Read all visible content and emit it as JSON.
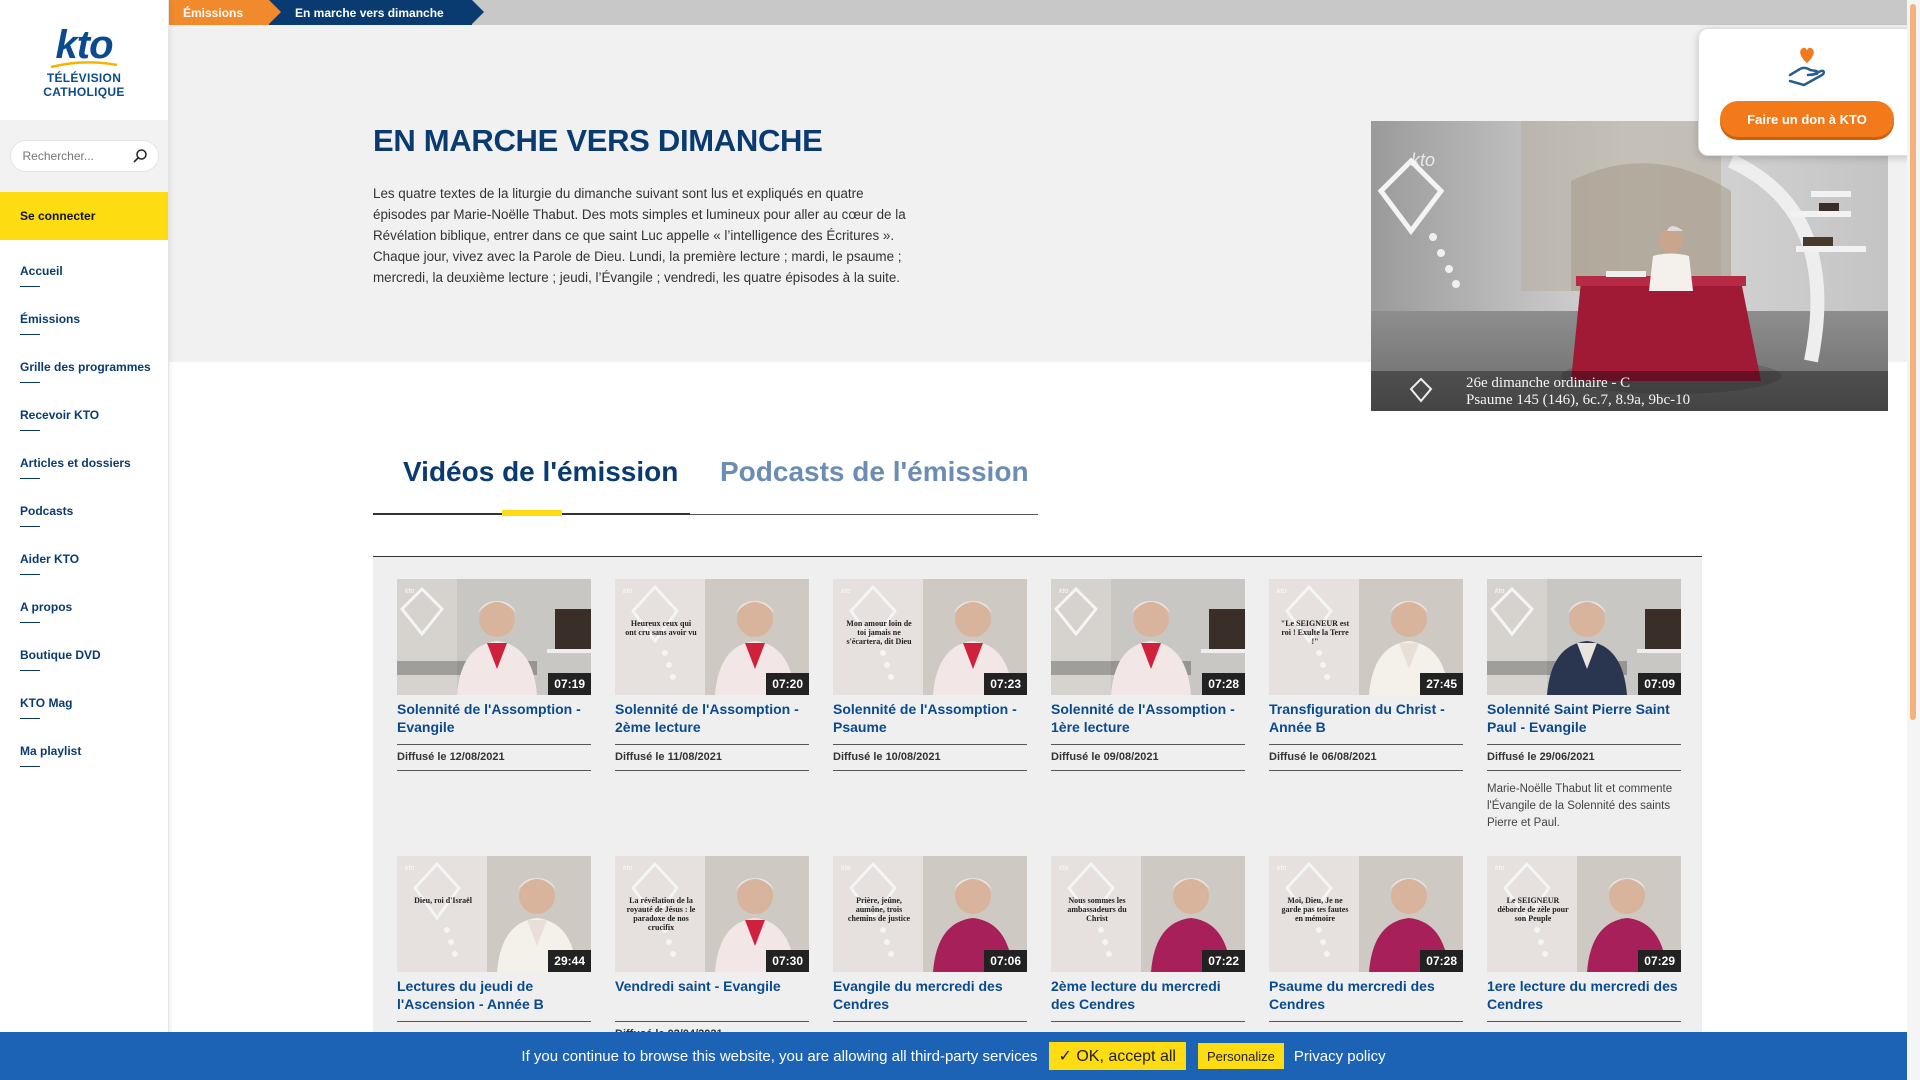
{
  "breadcrumb": {
    "item1": "Émissions",
    "item2": "En marche vers dimanche"
  },
  "logo": {
    "brand": "kto",
    "line1": "TÉLÉVISION",
    "line2": "CATHOLIQUE"
  },
  "search": {
    "placeholder": "Rechercher..."
  },
  "sidebar": {
    "connect": "Se connecter",
    "items": [
      {
        "label": "Accueil"
      },
      {
        "label": "Émissions"
      },
      {
        "label": "Grille des programmes"
      },
      {
        "label": "Recevoir KTO"
      },
      {
        "label": "Articles et dossiers"
      },
      {
        "label": "Podcasts"
      },
      {
        "label": "Aider KTO"
      },
      {
        "label": "A propos"
      },
      {
        "label": "Boutique DVD"
      },
      {
        "label": "KTO Mag"
      },
      {
        "label": "Ma playlist"
      }
    ]
  },
  "hero": {
    "title": "EN MARCHE VERS DIMANCHE",
    "description": "Les quatre textes de la liturgie du dimanche suivant sont lus et expliqués en quatre épisodes par Marie-Noëlle Thabut. Des mots simples et lumineux pour aller au cœur de la Révélation biblique, entrer dans ce que saint Luc appelle « l’intelligence des Écritures ». Chaque jour, vivez avec la Parole de Dieu. Lundi, la première lecture ; mardi, le psaume ; mercredi, la deuxième lecture ; jeudi, l’Évangile ; vendredi, les quatre épisodes à la suite.",
    "image_caption_line1": "26e dimanche ordinaire - C",
    "image_caption_line2": "Psaume 145 (146), 6c.7, 8.9a, 9bc-10"
  },
  "donate": {
    "label": "Faire un don à KTO"
  },
  "tabs": {
    "videos": "Vidéos de l'émission",
    "podcasts": "Podcasts de l'émission"
  },
  "videos": [
    {
      "title": "Solennité de l'Assomption - Evangile",
      "duration": "07:19",
      "date": "Diffusé le 12/08/2021",
      "thumb_text": "",
      "style": "set"
    },
    {
      "title": "Solennité de l'Assomption - 2ème lecture",
      "duration": "07:20",
      "date": "Diffusé le 11/08/2021",
      "thumb_text": "Heureux ceux qui ont cru sans avoir vu",
      "style": "split-pink"
    },
    {
      "title": "Solennité de l'Assomption - Psaume",
      "duration": "07:23",
      "date": "Diffusé le 10/08/2021",
      "thumb_text": "Mon amour loin de toi jamais ne s'écartera, dit Dieu",
      "style": "split-pink"
    },
    {
      "title": "Solennité de l'Assomption - 1ère lecture",
      "duration": "07:28",
      "date": "Diffusé le 09/08/2021",
      "thumb_text": "",
      "style": "set"
    },
    {
      "title": "Transfiguration du Christ - Année B",
      "duration": "27:45",
      "date": "Diffusé le 06/08/2021",
      "thumb_text": "\"Le SEIGNEUR est roi ! Exulte la Terre !\"",
      "style": "split-white"
    },
    {
      "title": "Solennité Saint Pierre Saint Paul - Evangile",
      "duration": "07:09",
      "date": "Diffusé le 29/06/2021",
      "thumb_text": "",
      "style": "set-navy",
      "desc": "Marie-Noëlle Thabut lit et commente l'Évangile de la Solennité des saints Pierre et Paul."
    },
    {
      "title": "Lectures du jeudi de l'Ascension - Année B",
      "duration": "29:44",
      "date": "",
      "thumb_text": "Dieu, roi d'Israël",
      "style": "split-white"
    },
    {
      "title": "Vendredi saint - Evangile",
      "duration": "07:30",
      "date": "Diffusé le 02/04/2021",
      "thumb_text": "La révélation de la royauté de Jésus : le paradoxe de nos crucifix",
      "style": "split-pink"
    },
    {
      "title": "Evangile du mercredi des Cendres",
      "duration": "07:06",
      "date": "",
      "thumb_text": "Prière, jeûne, aumône, trois chemins de justice",
      "style": "split-magenta"
    },
    {
      "title": "2ème lecture du mercredi des Cendres",
      "duration": "07:22",
      "date": "",
      "thumb_text": "Nous sommes les ambassadeurs du Christ",
      "style": "split-magenta"
    },
    {
      "title": "Psaume du mercredi des Cendres",
      "duration": "07:28",
      "date": "",
      "thumb_text": "Moi, Dieu, Je ne garde pas tes fautes en mémoire",
      "style": "split-magenta"
    },
    {
      "title": "1ere lecture du mercredi des Cendres",
      "duration": "07:29",
      "date": "",
      "thumb_text": "Le SEIGNEUR déborde de zèle pour son Peuple",
      "style": "split-magenta"
    }
  ],
  "cookie": {
    "text": "If you continue to browse this website, you are allowing all third-party services",
    "ok": "✓ OK, accept all",
    "personalize": "Personalize",
    "privacy": "Privacy policy"
  }
}
